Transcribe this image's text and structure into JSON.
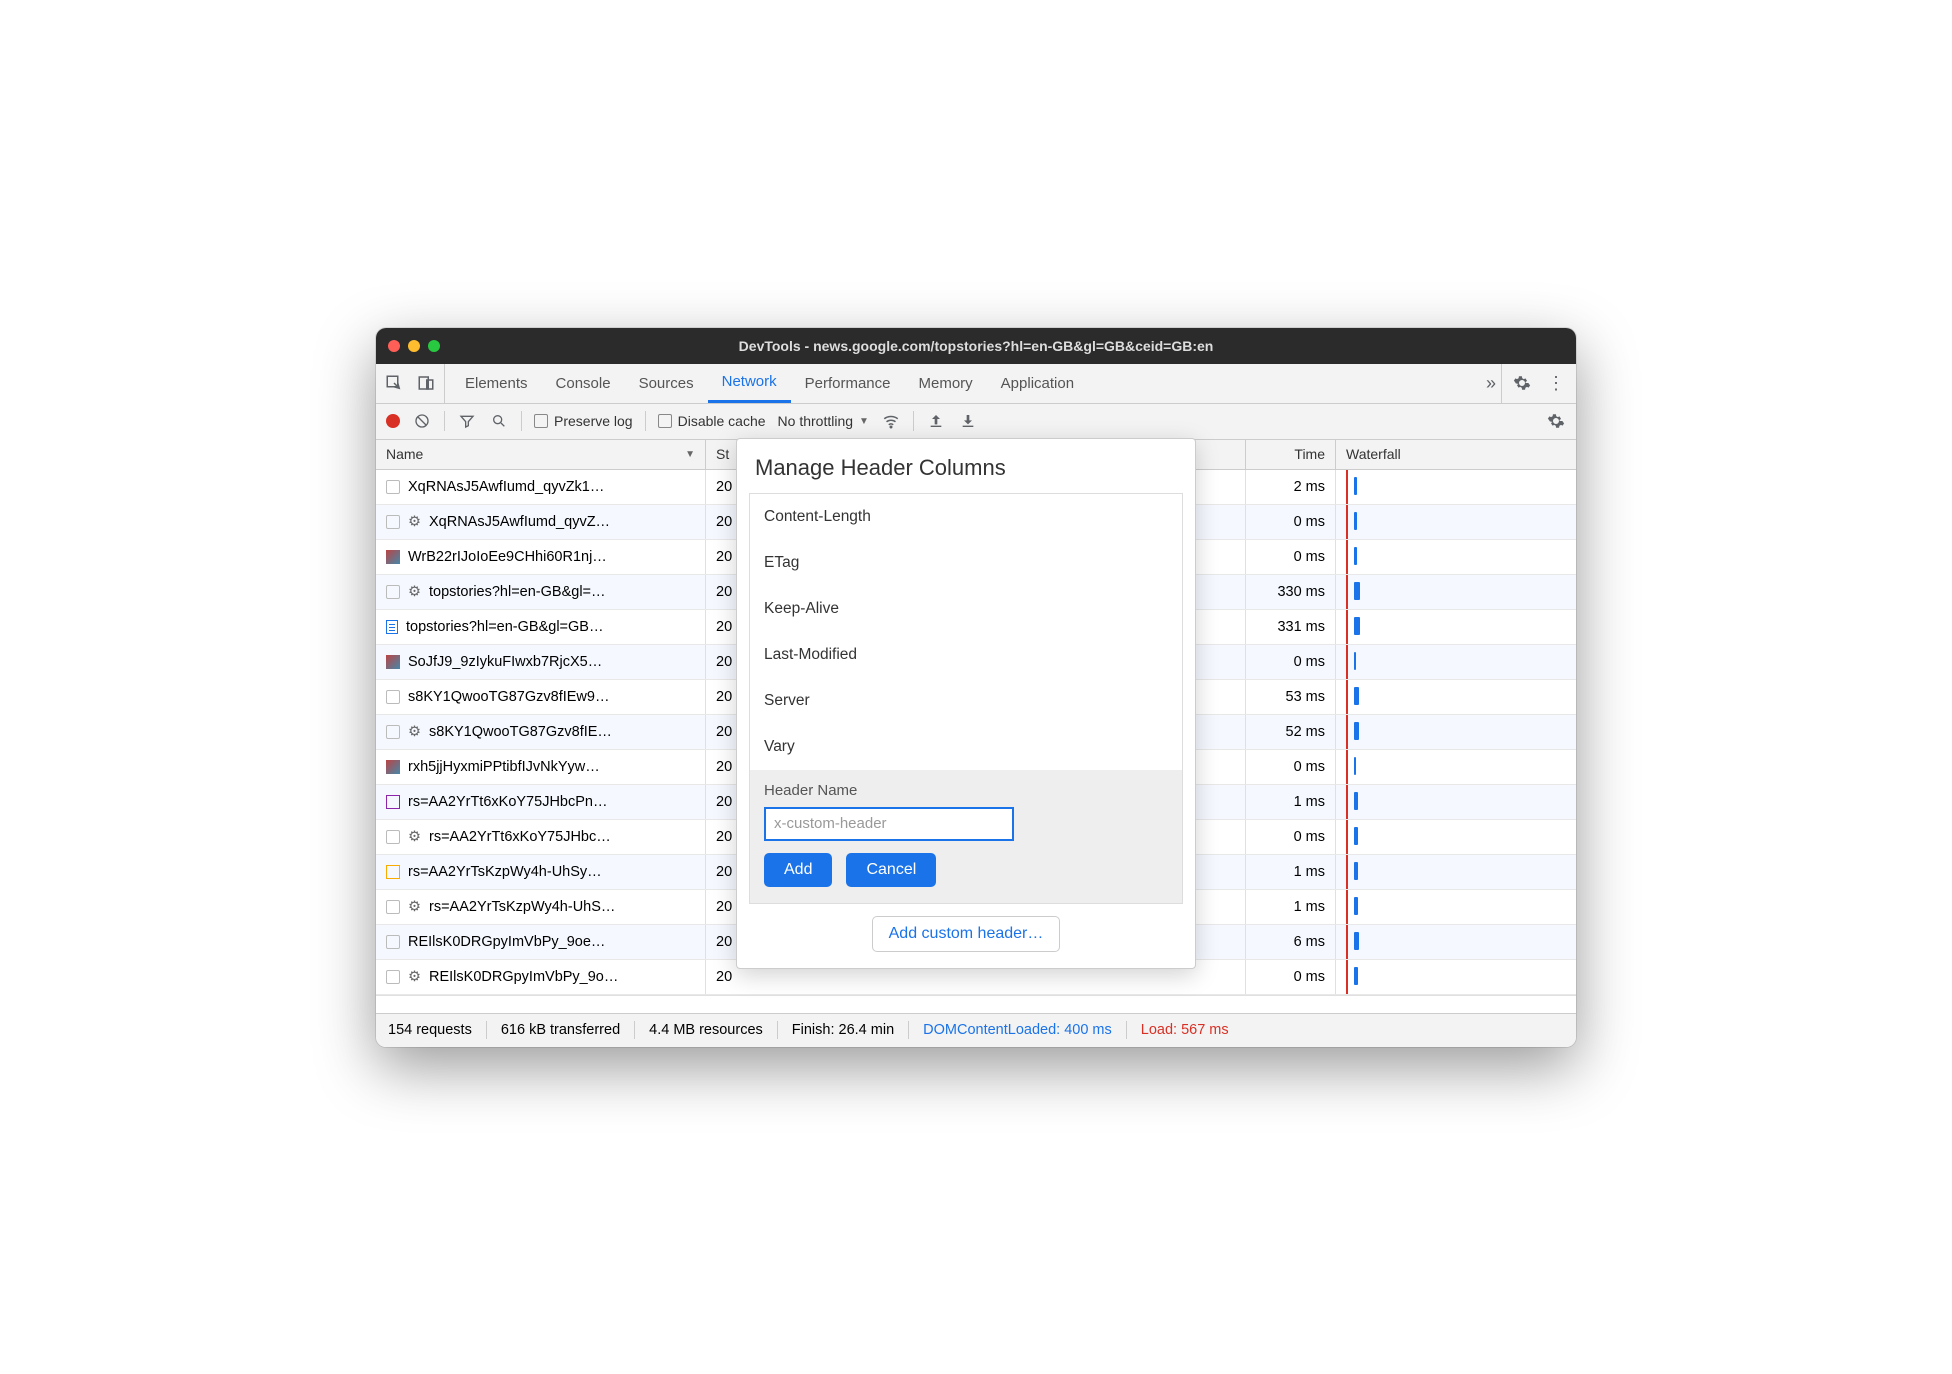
{
  "window": {
    "title": "DevTools - news.google.com/topstories?hl=en-GB&gl=GB&ceid=GB:en"
  },
  "tabs": {
    "items": [
      "Elements",
      "Console",
      "Sources",
      "Network",
      "Performance",
      "Memory",
      "Application"
    ],
    "active": "Network"
  },
  "toolbar": {
    "preserve_log": "Preserve log",
    "disable_cache": "Disable cache",
    "throttling": "No throttling"
  },
  "columns": {
    "name": "Name",
    "status": "St",
    "time": "Time",
    "waterfall": "Waterfall"
  },
  "rows": [
    {
      "icon": "blank",
      "name": "XqRNAsJ5AwfIumd_qyvZk1…",
      "status": "20",
      "time": "2 ms",
      "bar": 3
    },
    {
      "icon": "gear",
      "name": "XqRNAsJ5AwfIumd_qyvZ…",
      "status": "20",
      "time": "0 ms",
      "bar": 3
    },
    {
      "icon": "img",
      "name": "WrB22rIJoIoEe9CHhi60R1nj…",
      "status": "20",
      "time": "0 ms",
      "bar": 3
    },
    {
      "icon": "gear",
      "name": "topstories?hl=en-GB&gl=…",
      "status": "20",
      "time": "330 ms",
      "bar": 6
    },
    {
      "icon": "doc",
      "name": "topstories?hl=en-GB&gl=GB…",
      "status": "20",
      "time": "331 ms",
      "bar": 6
    },
    {
      "icon": "img",
      "name": "SoJfJ9_9zIykuFIwxb7RjcX5…",
      "status": "20",
      "time": "0 ms",
      "bar": 2
    },
    {
      "icon": "blank",
      "name": "s8KY1QwooTG87Gzv8fIEw9…",
      "status": "20",
      "time": "53 ms",
      "bar": 5
    },
    {
      "icon": "gear",
      "name": "s8KY1QwooTG87Gzv8fIE…",
      "status": "20",
      "time": "52 ms",
      "bar": 5
    },
    {
      "icon": "img",
      "name": "rxh5jjHyxmiPPtibfIJvNkYyw…",
      "status": "20",
      "time": "0 ms",
      "bar": 2
    },
    {
      "icon": "purple",
      "name": "rs=AA2YrTt6xKoY75JHbcPn…",
      "status": "20",
      "time": "1 ms",
      "bar": 4
    },
    {
      "icon": "gear",
      "name": "rs=AA2YrTt6xKoY75JHbc…",
      "status": "20",
      "time": "0 ms",
      "bar": 4
    },
    {
      "icon": "orange",
      "name": "rs=AA2YrTsKzpWy4h-UhSy…",
      "status": "20",
      "time": "1 ms",
      "bar": 4
    },
    {
      "icon": "gear",
      "name": "rs=AA2YrTsKzpWy4h-UhS…",
      "status": "20",
      "time": "1 ms",
      "bar": 4
    },
    {
      "icon": "blank",
      "name": "REIlsK0DRGpyImVbPy_9oe…",
      "status": "20",
      "time": "6 ms",
      "bar": 5
    },
    {
      "icon": "gear",
      "name": "REIlsK0DRGpyImVbPy_9o…",
      "status": "20",
      "time": "0 ms",
      "bar": 4
    }
  ],
  "modal": {
    "title": "Manage Header Columns",
    "headers": [
      "Content-Length",
      "ETag",
      "Keep-Alive",
      "Last-Modified",
      "Server",
      "Vary"
    ],
    "custom_label": "Header Name",
    "placeholder": "x-custom-header",
    "add": "Add",
    "cancel": "Cancel",
    "add_custom": "Add custom header…"
  },
  "statusbar": {
    "requests": "154 requests",
    "transferred": "616 kB transferred",
    "resources": "4.4 MB resources",
    "finish": "Finish: 26.4 min",
    "dcl": "DOMContentLoaded: 400 ms",
    "load": "Load: 567 ms"
  }
}
